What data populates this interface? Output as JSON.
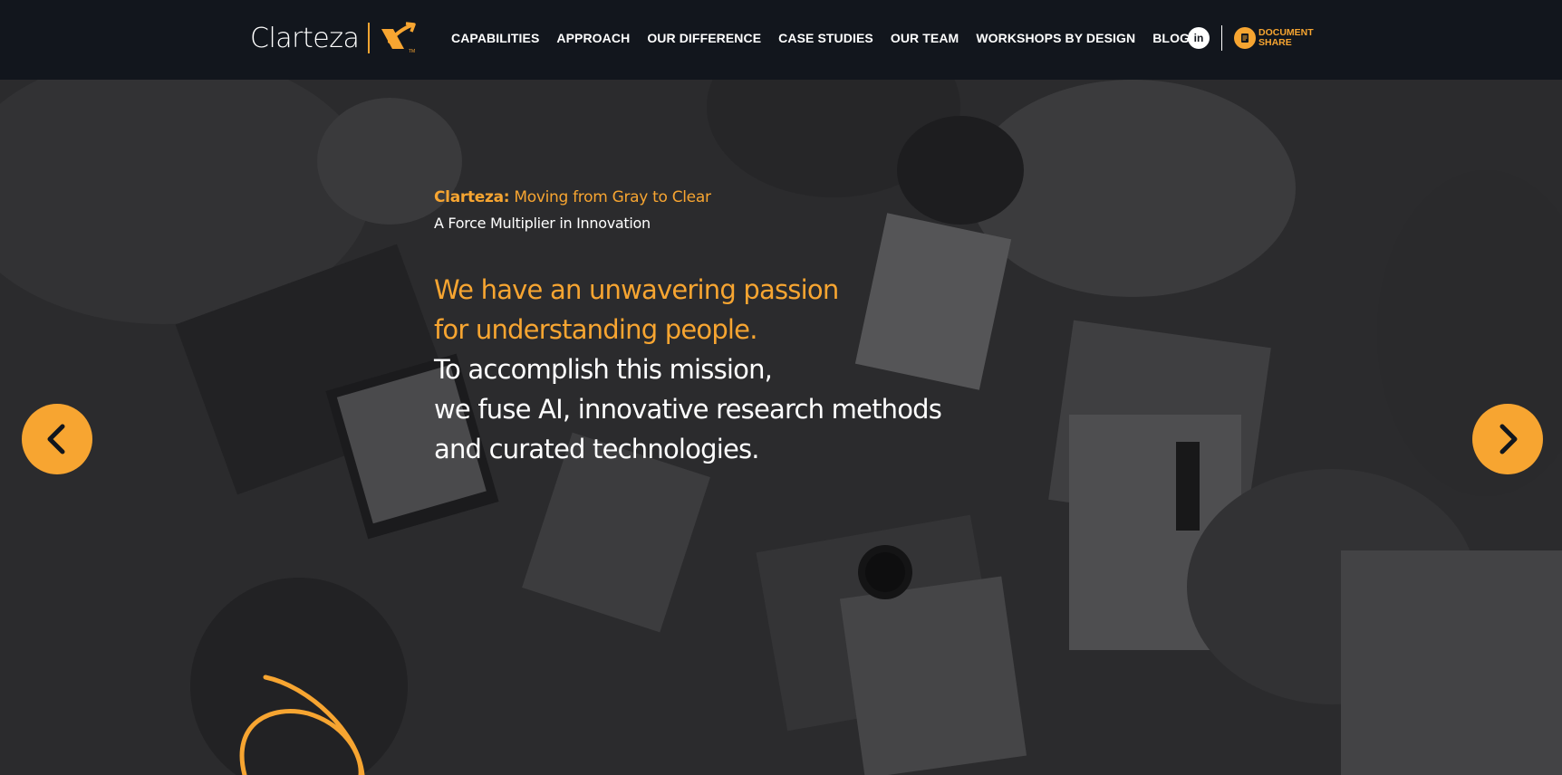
{
  "header": {
    "logo_text": "Clarteza",
    "nav": [
      {
        "label": "CAPABILITIES"
      },
      {
        "label": "APPROACH"
      },
      {
        "label": "OUR DIFFERENCE"
      },
      {
        "label": "CASE STUDIES"
      },
      {
        "label": "OUR TEAM"
      },
      {
        "label": "WORKSHOPS BY DESIGN"
      },
      {
        "label": "BLOG"
      }
    ],
    "social_icon": "linkedin-icon",
    "social_text": "in",
    "doc_share": {
      "line1": "DOCUMENT",
      "line2": "SHARE"
    }
  },
  "hero": {
    "brand": "Clarteza:",
    "tagline": "Moving from Gray to Clear",
    "subtitle": "A Force Multiplier in Innovation",
    "headline_orange": [
      "We have an unwavering passion",
      "for understanding people."
    ],
    "headline_white": [
      "To accomplish this mission,",
      "we fuse AI, innovative research methods",
      "and curated technologies."
    ]
  },
  "colors": {
    "accent": "#f7a531",
    "header_bg": "#12161d",
    "text": "#ffffff"
  },
  "icons": {
    "prev": "chevron-left-icon",
    "next": "chevron-right-icon",
    "doc": "document-icon"
  }
}
